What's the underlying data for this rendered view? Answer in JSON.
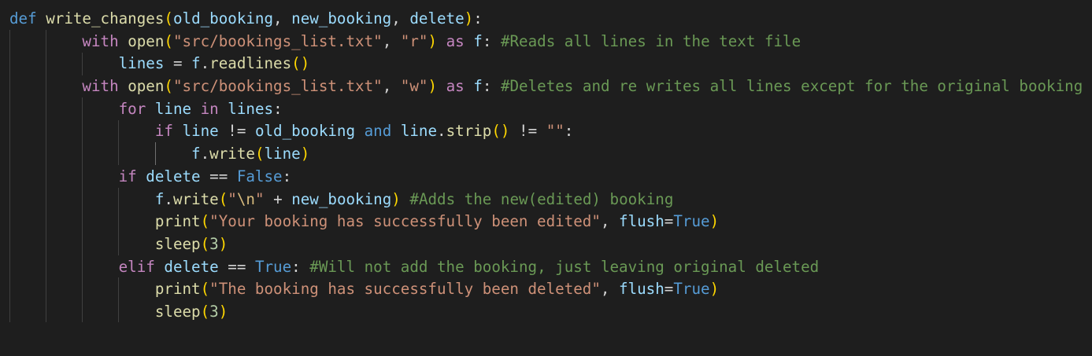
{
  "editor": {
    "language": "python",
    "theme": "dark",
    "colors": {
      "background": "#1e1e1e",
      "keyword": "#569cd6",
      "control": "#c586c0",
      "function": "#dcdcaa",
      "variable": "#9cdcfe",
      "string": "#ce9178",
      "number": "#b5cea8",
      "comment": "#6a9955",
      "bracket": "#ffd700"
    }
  },
  "code": {
    "l1": {
      "def": "def",
      "fn": "write_changes",
      "open": "(",
      "p1": "old_booking",
      "c1": ", ",
      "p2": "new_booking",
      "c2": ", ",
      "p3": "delete",
      "close": ")",
      "colon": ":"
    },
    "l2": {
      "with": "with",
      "fn": "open",
      "open": "(",
      "s1": "\"src/bookings_list.txt\"",
      "c1": ", ",
      "s2": "\"r\"",
      "close": ")",
      "as": "as",
      "f": "f",
      "colon": ":",
      "comment": "#Reads all lines in the text file"
    },
    "l3": {
      "lines": "lines",
      "eq": " = ",
      "f": "f",
      "dot": ".",
      "fn": "readlines",
      "parens": "()"
    },
    "l4": {
      "with": "with",
      "fn": "open",
      "open": "(",
      "s1": "\"src/bookings_list.txt\"",
      "c1": ", ",
      "s2": "\"w\"",
      "close": ")",
      "as": "as",
      "f": "f",
      "colon": ":",
      "comment": "#Deletes and re writes all lines except for the original booking"
    },
    "l5": {
      "for": "for",
      "line": "line",
      "in": "in",
      "lines": "lines",
      "colon": ":"
    },
    "l6": {
      "if": "if",
      "line": "line",
      "ne": " != ",
      "old": "old_booking",
      "and": "and",
      "line2": "line",
      "dot": ".",
      "fn": "strip",
      "parens": "()",
      "ne2": " != ",
      "empty": "\"\"",
      "colon": ":"
    },
    "l7": {
      "f": "f",
      "dot": ".",
      "fn": "write",
      "open": "(",
      "arg": "line",
      "close": ")"
    },
    "l8": {
      "if": "if",
      "delete": "delete",
      "eq": " == ",
      "false": "False",
      "colon": ":"
    },
    "l9": {
      "f": "f",
      "dot": ".",
      "fn": "write",
      "open": "(",
      "q1": "\"",
      "esc": "\\n",
      "q2": "\"",
      "plus": " + ",
      "arg": "new_booking",
      "close": ")",
      "comment": "#Adds the new(edited) booking"
    },
    "l10": {
      "fn": "print",
      "open": "(",
      "s": "\"Your booking has successfully been edited\"",
      "c": ", ",
      "kwarg": "flush",
      "eq": "=",
      "val": "True",
      "close": ")"
    },
    "l11": {
      "fn": "sleep",
      "open": "(",
      "n": "3",
      "close": ")"
    },
    "l12": {
      "elif": "elif",
      "delete": "delete",
      "eq": " == ",
      "true": "True",
      "colon": ":",
      "comment": "#Will not add the booking, just leaving original deleted"
    },
    "l13": {
      "fn": "print",
      "open": "(",
      "s": "\"The booking has successfully been deleted\"",
      "c": ", ",
      "kwarg": "flush",
      "eq": "=",
      "val": "True",
      "close": ")"
    },
    "l14": {
      "fn": "sleep",
      "open": "(",
      "n": "3",
      "close": ")"
    }
  }
}
